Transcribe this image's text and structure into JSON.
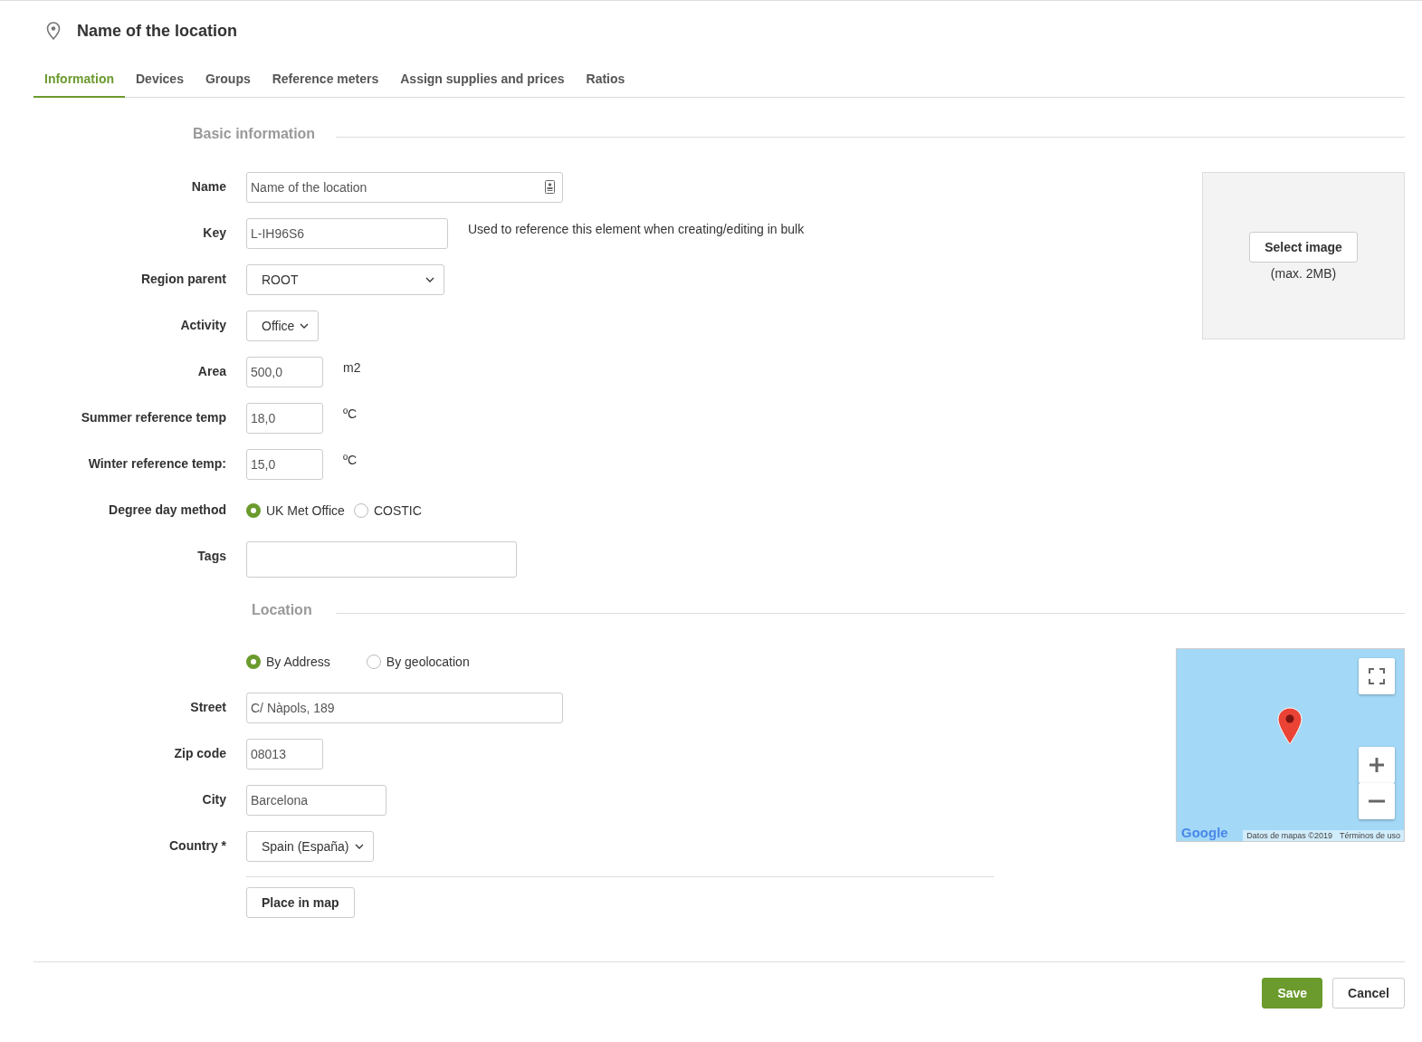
{
  "header": {
    "title": "Name of the location"
  },
  "tabs": [
    {
      "label": "Information",
      "selected": true
    },
    {
      "label": "Devices",
      "selected": false
    },
    {
      "label": "Groups",
      "selected": false
    },
    {
      "label": "Reference meters",
      "selected": false
    },
    {
      "label": "Assign supplies and prices",
      "selected": false
    },
    {
      "label": "Ratios",
      "selected": false
    }
  ],
  "basic": {
    "title": "Basic information",
    "fields": [
      {
        "kind": "text_icon",
        "label": "Name",
        "value": "Name of the location"
      },
      {
        "kind": "text",
        "label": "Key",
        "value": "L-IH96S6",
        "note": "Used to reference this element when creating/editing in bulk"
      },
      {
        "kind": "select",
        "label": "Region parent",
        "value": "ROOT"
      },
      {
        "kind": "select",
        "label": "Activity",
        "value": "Office"
      },
      {
        "kind": "text",
        "label": "Area",
        "value": "500,0",
        "note": "m2"
      },
      {
        "kind": "text",
        "label": "Summer reference temp",
        "value": "18,0",
        "note": "ºC"
      },
      {
        "kind": "text",
        "label": "Winter reference temp:",
        "value": "15,0",
        "note": "ºC"
      },
      {
        "kind": "radio",
        "label": "Degree day method",
        "options": [
          {
            "label": "UK Met Office",
            "selected": true
          },
          {
            "label": "COSTIC",
            "selected": false
          }
        ]
      },
      {
        "kind": "tags",
        "label": "Tags"
      }
    ],
    "image_panel": {
      "button": "Select image",
      "hint": "(max. 2MB)"
    }
  },
  "location": {
    "title": "Location",
    "fields": [
      {
        "kind": "radio",
        "options": [
          {
            "label": "By Address",
            "selected": true
          },
          {
            "label": "By geolocation",
            "selected": false
          }
        ]
      },
      {
        "kind": "text",
        "label": "Street",
        "value": "C/ Nàpols, 189"
      },
      {
        "kind": "text",
        "label": "Zip code",
        "value": "08013"
      },
      {
        "kind": "text",
        "label": "City",
        "value": "Barcelona"
      },
      {
        "kind": "select",
        "label": "Country *",
        "value": "Spain (España)"
      }
    ],
    "action": "Place in map",
    "map": {
      "logo": "Google",
      "attribution": "Datos de mapas ©2019",
      "terms": "Términos de uso"
    }
  },
  "footer": {
    "buttons": [
      {
        "label": "Save",
        "kind": "primary"
      },
      {
        "label": "Cancel",
        "kind": "default"
      }
    ]
  }
}
